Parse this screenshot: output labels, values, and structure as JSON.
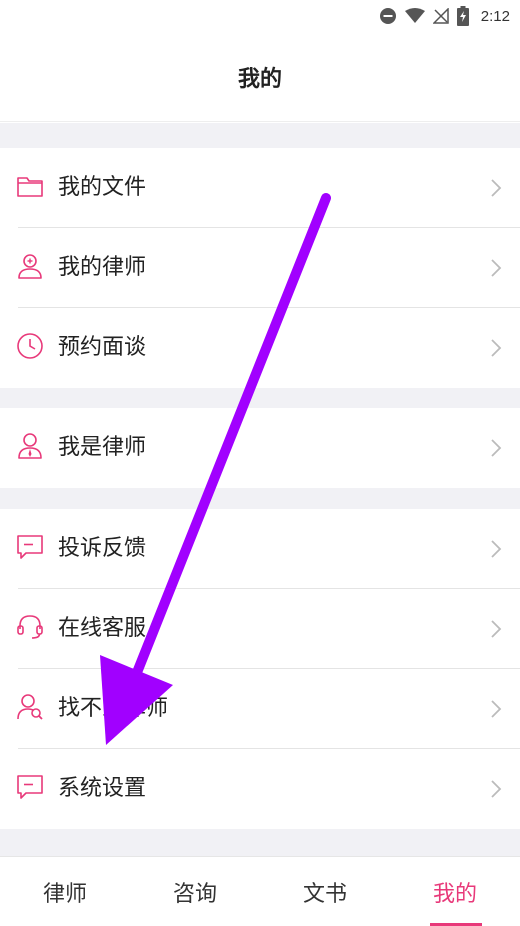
{
  "status": {
    "time": "2:12"
  },
  "header": {
    "title": "我的"
  },
  "menu": {
    "my_files": "我的文件",
    "my_lawyer": "我的律师",
    "appointment": "预约面谈",
    "i_am_lawyer": "我是律师",
    "complaint": "投诉反馈",
    "online_service": "在线客服",
    "cant_find_lawyer": "找不到律师",
    "settings": "系统设置"
  },
  "tabs": [
    "律师",
    "咨询",
    "文书",
    "我的"
  ],
  "colors": {
    "accent": "#e8397a",
    "annotation_arrow": "#a100ff",
    "section_gap": "#f1f1f5"
  }
}
